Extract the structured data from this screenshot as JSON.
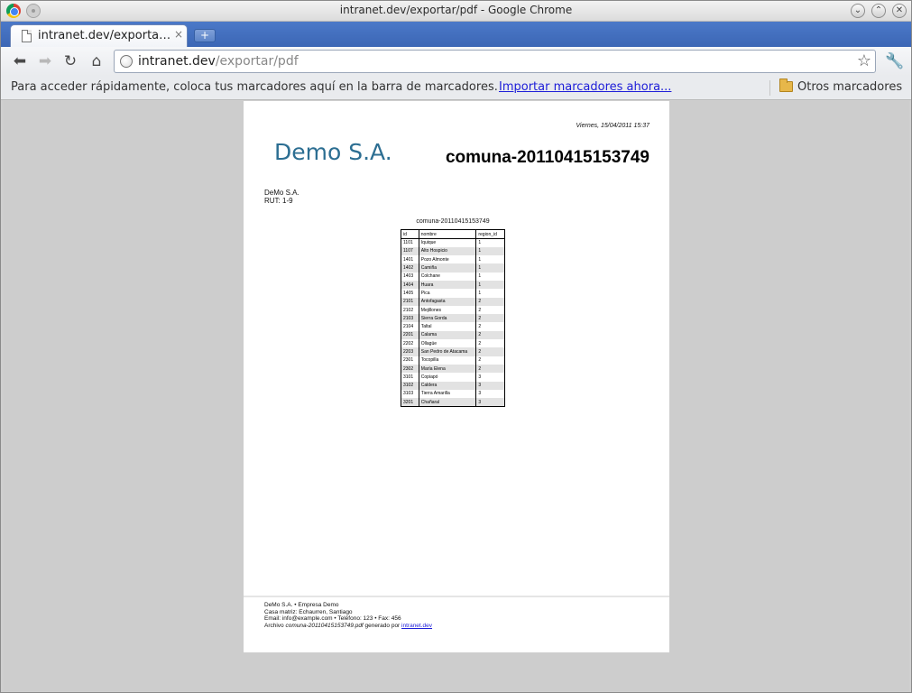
{
  "window": {
    "title": "intranet.dev/exportar/pdf - Google Chrome"
  },
  "tab": {
    "label": "intranet.dev/exporta…",
    "close": "×",
    "new_tab": "+"
  },
  "toolbar": {
    "back": "⬅",
    "forward": "➡",
    "reload": "↻",
    "home": "⌂",
    "url_host": "intranet.dev",
    "url_path": "/exportar/pdf",
    "star": "☆",
    "wrench": "🔧"
  },
  "bookmarks_bar": {
    "text": "Para acceder rápidamente, coloca tus marcadores aquí en la barra de marcadores.",
    "import_link": "Importar marcadores ahora...",
    "others": "Otros marcadores"
  },
  "pdf": {
    "date": "Viernes, 15/04/2011 15:37",
    "logo": "Demo S.A.",
    "doc_title": "comuna-20110415153749",
    "company_name": "DeMo S.A.",
    "company_rut": "RUT: 1-9",
    "table_caption": "comuna-20110415153749",
    "table_headers": [
      "id",
      "nombre",
      "region_id"
    ],
    "rows": [
      [
        "1101",
        "Iquique",
        "1"
      ],
      [
        "1107",
        "Alto Hospicio",
        "1"
      ],
      [
        "1401",
        "Pozo Almonte",
        "1"
      ],
      [
        "1402",
        "Camiña",
        "1"
      ],
      [
        "1403",
        "Colchane",
        "1"
      ],
      [
        "1404",
        "Huara",
        "1"
      ],
      [
        "1405",
        "Pica",
        "1"
      ],
      [
        "2101",
        "Antofagasta",
        "2"
      ],
      [
        "2102",
        "Mejillones",
        "2"
      ],
      [
        "2103",
        "Sierra Gorda",
        "2"
      ],
      [
        "2104",
        "Taltal",
        "2"
      ],
      [
        "2201",
        "Calama",
        "2"
      ],
      [
        "2202",
        "Ollagüe",
        "2"
      ],
      [
        "2203",
        "San Pedro de Atacama",
        "2"
      ],
      [
        "2301",
        "Tocopilla",
        "2"
      ],
      [
        "2302",
        "María Elena",
        "2"
      ],
      [
        "3101",
        "Copiapó",
        "3"
      ],
      [
        "3102",
        "Caldera",
        "3"
      ],
      [
        "3103",
        "Tierra Amarilla",
        "3"
      ],
      [
        "3201",
        "Chañaral",
        "3"
      ]
    ],
    "footer": {
      "line1": "DeMo S.A. • Empresa Demo",
      "line2": "Casa matriz: Echaurren, Santiago",
      "line3": "Email: info@example.com • Teléfono: 123 • Fax: 456",
      "line4_prefix": "Archivo ",
      "line4_file": "comuna-20110415153749.pdf",
      "line4_mid": " generado por ",
      "line4_link": "intranet.dev"
    }
  }
}
